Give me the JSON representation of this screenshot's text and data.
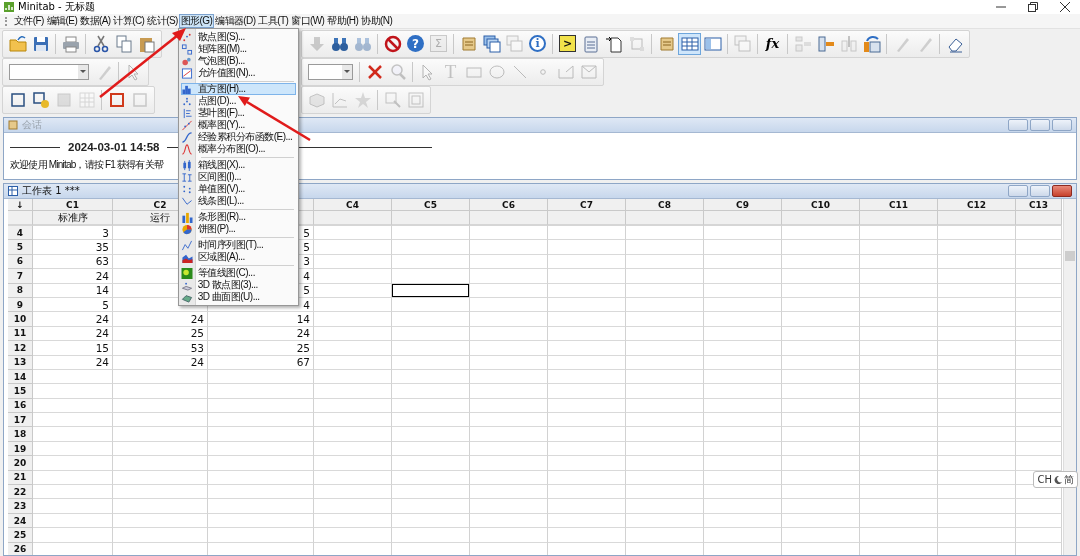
{
  "window": {
    "title": "Minitab - 无标题"
  },
  "menu_bar": [
    {
      "label": "文件(F)",
      "selected": false
    },
    {
      "label": "编辑(E)",
      "selected": false
    },
    {
      "label": "数据(A)",
      "selected": false
    },
    {
      "label": "计算(C)",
      "selected": false
    },
    {
      "label": "统计(S)",
      "selected": false
    },
    {
      "label": "图形(G)",
      "selected": true
    },
    {
      "label": "编辑器(D)",
      "selected": false
    },
    {
      "label": "工具(T)",
      "selected": false
    },
    {
      "label": "窗口(W)",
      "selected": false
    },
    {
      "label": "帮助(H)",
      "selected": false
    },
    {
      "label": "协助(N)",
      "selected": false
    }
  ],
  "toolbars": [
    {
      "left": [
        {
          "kind": "button",
          "disabled": false,
          "pressed": false
        },
        {
          "kind": "button",
          "disabled": false,
          "pressed": false
        },
        {
          "kind": "separator"
        },
        {
          "kind": "button",
          "disabled": false,
          "pressed": false
        },
        {
          "kind": "separator"
        },
        {
          "kind": "button",
          "disabled": false,
          "pressed": false
        },
        {
          "kind": "button",
          "disabled": false,
          "pressed": false
        },
        {
          "kind": "button",
          "disabled": false,
          "pressed": false
        }
      ],
      "right": [
        {
          "kind": "button",
          "disabled": true,
          "pressed": false
        },
        {
          "kind": "button",
          "disabled": false,
          "pressed": false
        },
        {
          "kind": "button",
          "disabled": true,
          "pressed": false
        },
        {
          "kind": "separator"
        },
        {
          "kind": "button",
          "disabled": false,
          "pressed": false
        },
        {
          "kind": "button",
          "disabled": false,
          "pressed": false,
          "glyph": "?"
        },
        {
          "kind": "button",
          "disabled": true,
          "pressed": false,
          "glyph": "Σ"
        },
        {
          "kind": "separator"
        },
        {
          "kind": "button",
          "disabled": false,
          "pressed": false
        },
        {
          "kind": "button",
          "disabled": false,
          "pressed": false
        },
        {
          "kind": "button",
          "disabled": true,
          "pressed": false
        },
        {
          "kind": "button",
          "disabled": false,
          "pressed": false,
          "glyph": "i"
        },
        {
          "kind": "separator"
        },
        {
          "kind": "button",
          "disabled": false,
          "pressed": false,
          "glyph": ">"
        },
        {
          "kind": "button",
          "disabled": false,
          "pressed": false
        },
        {
          "kind": "button",
          "disabled": false,
          "pressed": false
        },
        {
          "kind": "button",
          "disabled": true,
          "pressed": false
        },
        {
          "kind": "separator"
        },
        {
          "kind": "button",
          "disabled": false,
          "pressed": false
        },
        {
          "kind": "button",
          "disabled": false,
          "pressed": true
        },
        {
          "kind": "button",
          "disabled": false,
          "pressed": false
        },
        {
          "kind": "separator"
        },
        {
          "kind": "button",
          "disabled": true,
          "pressed": false
        },
        {
          "kind": "separator"
        },
        {
          "kind": "button",
          "disabled": false,
          "pressed": false,
          "glyph": "fx"
        },
        {
          "kind": "separator"
        },
        {
          "kind": "button",
          "disabled": true,
          "pressed": false
        },
        {
          "kind": "button",
          "disabled": false,
          "pressed": false
        },
        {
          "kind": "button",
          "disabled": true,
          "pressed": false
        },
        {
          "kind": "button",
          "disabled": false,
          "pressed": false
        },
        {
          "kind": "separator"
        },
        {
          "kind": "button",
          "disabled": true,
          "pressed": false
        },
        {
          "kind": "button",
          "disabled": true,
          "pressed": false
        },
        {
          "kind": "separator"
        },
        {
          "kind": "button",
          "disabled": false,
          "pressed": false
        }
      ]
    },
    {
      "left": [
        {
          "kind": "combo"
        },
        {
          "kind": "button",
          "disabled": true,
          "pressed": false
        },
        {
          "kind": "separator"
        },
        {
          "kind": "button",
          "disabled": true,
          "pressed": false
        }
      ],
      "right": [
        {
          "kind": "combo"
        },
        {
          "kind": "separator"
        },
        {
          "kind": "button",
          "disabled": false,
          "pressed": false
        },
        {
          "kind": "button",
          "disabled": true,
          "pressed": false
        },
        {
          "kind": "separator"
        },
        {
          "kind": "button",
          "disabled": true,
          "pressed": false
        },
        {
          "kind": "button",
          "disabled": true,
          "pressed": false,
          "glyph": "T"
        },
        {
          "kind": "button",
          "disabled": true,
          "pressed": false
        },
        {
          "kind": "button",
          "disabled": true,
          "pressed": false
        },
        {
          "kind": "button",
          "disabled": true,
          "pressed": false
        },
        {
          "kind": "button",
          "disabled": true,
          "pressed": false
        },
        {
          "kind": "button",
          "disabled": true,
          "pressed": false
        },
        {
          "kind": "button",
          "disabled": true,
          "pressed": false
        }
      ]
    },
    {
      "left": [
        {
          "kind": "button",
          "disabled": false,
          "pressed": false
        },
        {
          "kind": "button",
          "disabled": false,
          "pressed": false
        },
        {
          "kind": "button",
          "disabled": true,
          "pressed": false
        },
        {
          "kind": "button",
          "disabled": true,
          "pressed": false
        },
        {
          "kind": "separator"
        },
        {
          "kind": "button",
          "disabled": false,
          "pressed": false
        },
        {
          "kind": "button",
          "disabled": true,
          "pressed": false
        }
      ],
      "right": [
        {
          "kind": "button",
          "disabled": true,
          "pressed": false
        },
        {
          "kind": "button",
          "disabled": true,
          "pressed": false
        },
        {
          "kind": "button",
          "disabled": true,
          "pressed": false
        },
        {
          "kind": "separator"
        },
        {
          "kind": "button",
          "disabled": true,
          "pressed": false
        },
        {
          "kind": "button",
          "disabled": true,
          "pressed": false
        }
      ]
    }
  ],
  "graph_menu": {
    "groups": [
      [
        {
          "label": "散点图(S)...",
          "selected": false
        },
        {
          "label": "矩阵图(M)...",
          "selected": false
        },
        {
          "label": "气泡图(B)...",
          "selected": false
        },
        {
          "label": "允许值图(N)...",
          "selected": false
        }
      ],
      [
        {
          "label": "直方图(H)...",
          "selected": true
        },
        {
          "label": "点图(D)...",
          "selected": false
        },
        {
          "label": "茎叶图(F)...",
          "selected": false
        },
        {
          "label": "概率图(Y)...",
          "selected": false
        },
        {
          "label": "经验累积分布函数(E)...",
          "selected": false
        },
        {
          "label": "概率分布图(O)...",
          "selected": false
        }
      ],
      [
        {
          "label": "箱线图(X)...",
          "selected": false
        },
        {
          "label": "区间图(I)...",
          "selected": false
        },
        {
          "label": "单值图(V)...",
          "selected": false
        },
        {
          "label": "线条图(L)...",
          "selected": false
        }
      ],
      [
        {
          "label": "条形图(R)...",
          "selected": false
        },
        {
          "label": "饼图(P)...",
          "selected": false
        }
      ],
      [
        {
          "label": "时间序列图(T)...",
          "selected": false
        },
        {
          "label": "区域图(A)...",
          "selected": false
        }
      ],
      [
        {
          "label": "等值线图(C)...",
          "selected": false
        },
        {
          "label": "3D 散点图(3)...",
          "selected": false
        },
        {
          "label": "3D 曲面图(U)...",
          "selected": false
        }
      ]
    ]
  },
  "session": {
    "title": "会话",
    "timestamp": "2024-03-01 14:58",
    "message": "欢迎使用 Minitab，请按 F1 获得有关帮"
  },
  "worksheet": {
    "title": "工作表 1 ***",
    "corner": "↓",
    "columns": [
      {
        "label": "C1",
        "name": "标准序"
      },
      {
        "label": "C2",
        "name": "运行"
      },
      {},
      {
        "label": "C4"
      },
      {
        "label": "C5"
      },
      {
        "label": "C6"
      },
      {
        "label": "C7"
      },
      {
        "label": "C8"
      },
      {
        "label": "C9"
      },
      {
        "label": "C10"
      },
      {
        "label": "C11"
      },
      {
        "label": "C12"
      },
      {
        "label": "C13"
      }
    ],
    "rows": [
      {
        "number": "4",
        "cells": [
          {
            "value": "3",
            "selected": false
          },
          {
            "selected": false
          },
          {
            "value": "5",
            "selected": false
          },
          {
            "selected": false
          },
          {
            "selected": false
          }
        ]
      },
      {
        "number": "5",
        "cells": [
          {
            "value": "35",
            "selected": false
          },
          {
            "selected": false
          },
          {
            "value": "5",
            "selected": false
          },
          {
            "selected": false
          },
          {
            "selected": false
          }
        ]
      },
      {
        "number": "6",
        "cells": [
          {
            "value": "63",
            "selected": false
          },
          {
            "selected": false
          },
          {
            "value": "3",
            "selected": false
          },
          {
            "selected": false
          },
          {
            "selected": false
          }
        ]
      },
      {
        "number": "7",
        "cells": [
          {
            "value": "24",
            "selected": false
          },
          {
            "selected": false
          },
          {
            "value": "4",
            "selected": false
          },
          {
            "selected": false
          },
          {
            "selected": false
          }
        ]
      },
      {
        "number": "8",
        "cells": [
          {
            "value": "14",
            "selected": false
          },
          {
            "selected": false
          },
          {
            "value": "5",
            "selected": false
          },
          {
            "selected": false
          },
          {
            "selected": true
          }
        ]
      },
      {
        "number": "9",
        "cells": [
          {
            "value": "5",
            "selected": false
          },
          {
            "selected": false
          },
          {
            "value": "4",
            "selected": false
          },
          {
            "selected": false
          },
          {
            "selected": false
          }
        ]
      },
      {
        "number": "10",
        "cells": [
          {
            "value": "24",
            "selected": false
          },
          {
            "value": "24",
            "selected": false
          },
          {
            "value": "14",
            "selected": false
          },
          {
            "selected": false
          },
          {
            "selected": false
          }
        ]
      },
      {
        "number": "11",
        "cells": [
          {
            "value": "24",
            "selected": false
          },
          {
            "value": "25",
            "selected": false
          },
          {
            "value": "24",
            "selected": false
          },
          {
            "selected": false
          },
          {
            "selected": false
          }
        ]
      },
      {
        "number": "12",
        "cells": [
          {
            "value": "15",
            "selected": false
          },
          {
            "value": "53",
            "selected": false
          },
          {
            "value": "25",
            "selected": false
          },
          {
            "selected": false
          },
          {
            "selected": false
          }
        ]
      },
      {
        "number": "13",
        "cells": [
          {
            "value": "24",
            "selected": false
          },
          {
            "value": "24",
            "selected": false
          },
          {
            "value": "67",
            "selected": false
          },
          {
            "selected": false
          },
          {
            "selected": false
          }
        ]
      },
      {
        "number": "14"
      },
      {
        "number": "15"
      },
      {
        "number": "16"
      },
      {
        "number": "17"
      },
      {
        "number": "18"
      },
      {
        "number": "19"
      },
      {
        "number": "20"
      },
      {
        "number": "21"
      },
      {
        "number": "22"
      },
      {
        "number": "23"
      },
      {
        "number": "24"
      },
      {
        "number": "25"
      },
      {
        "number": "26"
      }
    ]
  },
  "ime": {
    "language": "CH",
    "mode": "简"
  }
}
